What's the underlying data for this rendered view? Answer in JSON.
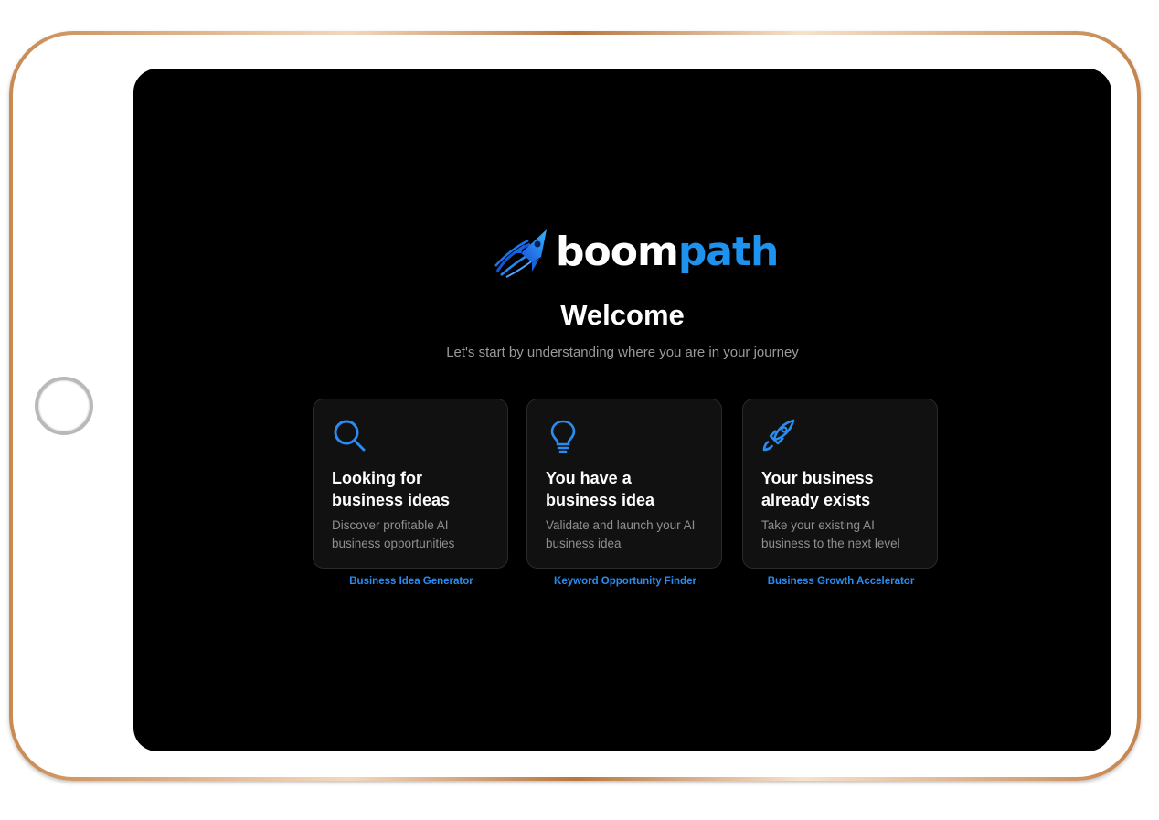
{
  "brand": {
    "name_part1": "boom",
    "name_part2": "path",
    "color_white": "#ffffff",
    "color_blue": "#1d93ef"
  },
  "welcome": {
    "title": "Welcome",
    "subtitle": "Let's start by understanding where you are in your journey"
  },
  "cards": [
    {
      "icon": "search-icon",
      "title_line1": "Looking for",
      "title_line2": "business ideas",
      "desc_line1": "Discover profitable AI",
      "desc_line2": "business opportunities",
      "link": "Business Idea Generator"
    },
    {
      "icon": "lightbulb-icon",
      "title_line1": "You have a",
      "title_line2": "business idea",
      "desc_line1": "Validate and launch your AI",
      "desc_line2": "business idea",
      "link": "Keyword Opportunity Finder"
    },
    {
      "icon": "rocket-icon",
      "title_line1": "Your business",
      "title_line2": "already exists",
      "desc_line1": "Take your existing AI",
      "desc_line2": "business to the next level",
      "link": "Business Growth Accelerator"
    }
  ],
  "colors": {
    "screen_bg": "#000000",
    "card_bg": "#111111",
    "accent": "#2a8cf0"
  }
}
